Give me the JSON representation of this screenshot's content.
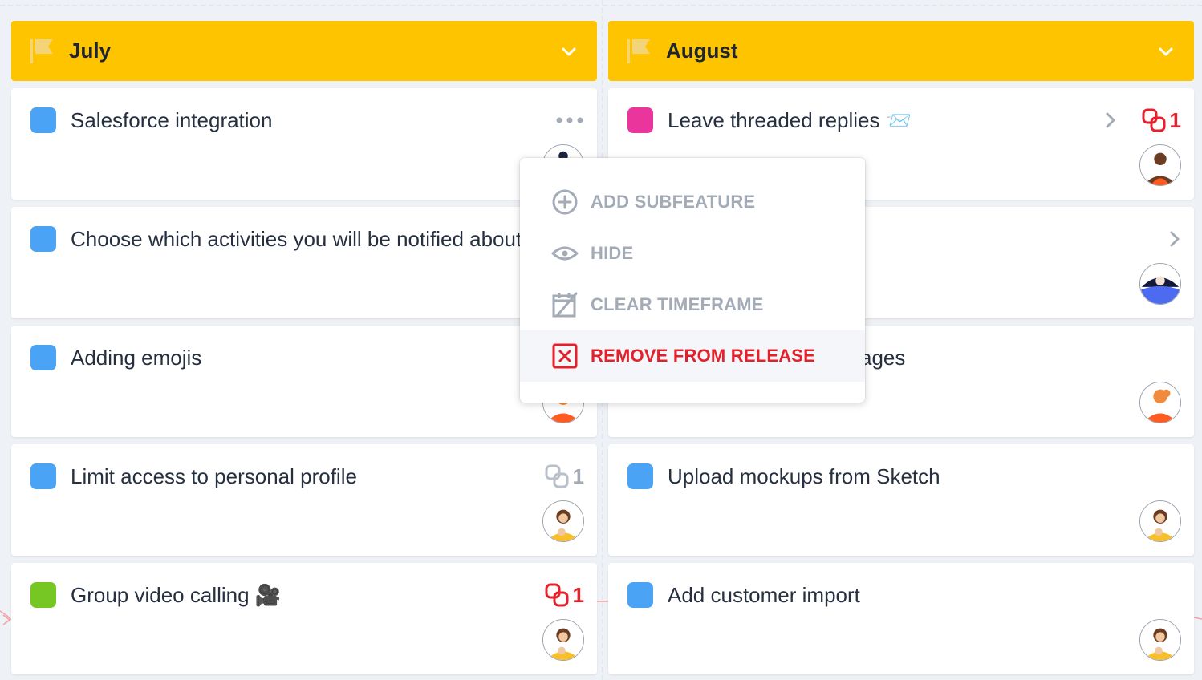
{
  "colors": {
    "header_bg": "#ffc400",
    "flag": "#f4d47a",
    "blue": "#4aa3f5",
    "magenta": "#e9359c",
    "green": "#76c723",
    "danger": "#e5202a",
    "muted": "#a3abb6"
  },
  "releases": [
    {
      "title": "July",
      "cards": [
        {
          "title": "Salesforce integration",
          "status_color": "#4aa3f5",
          "dep_count": ""
        },
        {
          "title": "Choose which activities you will be notified about",
          "status_color": "#4aa3f5",
          "dep_count": ""
        },
        {
          "title": "Adding emojis",
          "status_color": "#4aa3f5",
          "dep_count": ""
        },
        {
          "title": "Limit access to personal profile",
          "status_color": "#4aa3f5",
          "dep_count": "1"
        },
        {
          "title": "Group video calling 🎥",
          "status_color": "#76c723",
          "dep_count": "1"
        }
      ]
    },
    {
      "title": "August",
      "cards": [
        {
          "title": "Leave threaded replies 📨",
          "status_color": "#e9359c",
          "dep_count": "1"
        },
        {
          "title": "",
          "status_color": "",
          "dep_count": ""
        },
        {
          "title": "ages",
          "status_color": "",
          "dep_count": ""
        },
        {
          "title": "Upload mockups from Sketch",
          "status_color": "#4aa3f5",
          "dep_count": ""
        },
        {
          "title": "Add customer import",
          "status_color": "#4aa3f5",
          "dep_count": ""
        }
      ]
    }
  ],
  "context_menu": {
    "items": [
      {
        "label": "ADD SUBFEATURE",
        "icon": "plus-circle-icon"
      },
      {
        "label": "HIDE",
        "icon": "eye-icon"
      },
      {
        "label": "CLEAR TIMEFRAME",
        "icon": "calendar-clear-icon"
      },
      {
        "label": "REMOVE FROM RELEASE",
        "icon": "remove-x-icon"
      }
    ]
  }
}
